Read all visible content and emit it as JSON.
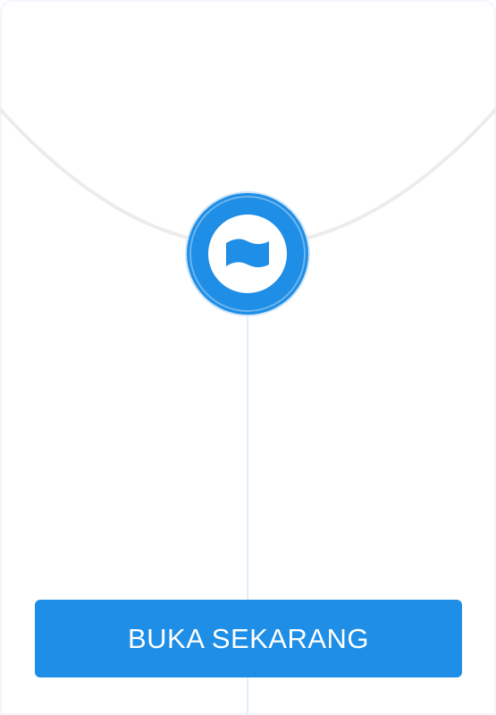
{
  "envelope": {
    "icon": "banknote-icon",
    "button_label": "BUKA SEKARANG"
  },
  "colors": {
    "accent": "#1e8ee6",
    "background": "#ffffff",
    "flap_line": "#ececec"
  }
}
